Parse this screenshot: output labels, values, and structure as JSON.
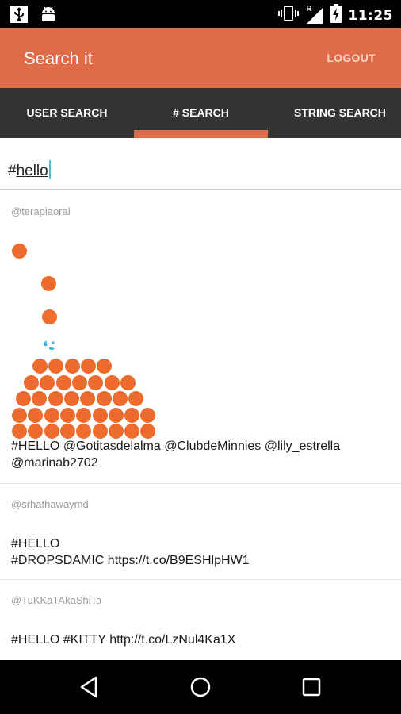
{
  "status_bar": {
    "time": "11:25",
    "network_label": "R"
  },
  "app_bar": {
    "title": "Search it",
    "logout_label": "LOGOUT"
  },
  "tabs": [
    {
      "label": "USER SEARCH",
      "selected": false
    },
    {
      "label": "# SEARCH",
      "selected": true
    },
    {
      "label": "STRING SEARCH",
      "selected": false
    }
  ],
  "search": {
    "prefix": "#",
    "value": "hello"
  },
  "tweets": [
    {
      "user": "@terapiaoral",
      "text": "#HELLO @Gotitasdelalma @ClubdeMinnies @lily_estrella @marinab2702"
    },
    {
      "user": "@srhathawaymd",
      "text_line1": "#HELLO",
      "text_line2": "#DROPSDAMIC https://t.co/B9ESHlpHW1"
    },
    {
      "user": "@TuKKaTAkaShiTa",
      "text": "#HELLO #KITTY http://t.co/LzNul4Ka1X"
    }
  ],
  "colors": {
    "accent": "#E06B47",
    "tab_bar": "#333333",
    "dot": "#EC6B2D",
    "drop": "#3BAFD9"
  }
}
